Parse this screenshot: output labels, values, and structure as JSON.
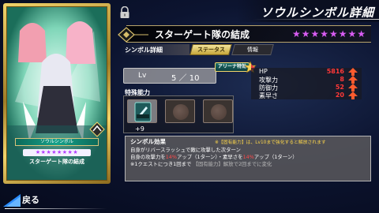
{
  "header": {
    "title": "ソウルシンボル詳細"
  },
  "card": {
    "caption": "ソウルシンボル",
    "stars": "★★★★★★★★",
    "name": "スターゲート隊の結成"
  },
  "symbol": {
    "name": "スターゲート隊の結成",
    "rarity_stars": "★★★★★★★★"
  },
  "tabs": {
    "symbol_detail": "シンボル詳細",
    "status": "ステータス",
    "info": "情報"
  },
  "level": {
    "label": "Lv",
    "value": "5 ／ 10"
  },
  "arena_badge": "アリーナ特効",
  "stats": [
    {
      "label": "HP",
      "value": "5816"
    },
    {
      "label": "攻撃力",
      "value": "8"
    },
    {
      "label": "防御力",
      "value": "52"
    },
    {
      "label": "素早さ",
      "value": "20"
    }
  ],
  "special_ability": {
    "title": "特殊能力",
    "plus": "+9"
  },
  "effect": {
    "title": "シンボル効果",
    "note": "※【固有能力】は、Lv10まで強化すると解放されます",
    "line1": "自身がリバースラッシュで敵に攻撃した次ターン",
    "line2_a": "自身の攻撃力を",
    "line2_p1": "14%",
    "line2_b": "アップ（1ターン）・素早さを",
    "line2_p2": "14%",
    "line2_c": "アップ（1ターン）",
    "line3_a": "※1クエストにつき1回まで",
    "line3_b": "【固有能力】解放で2回までに変化"
  },
  "back": {
    "label": "戻る"
  }
}
